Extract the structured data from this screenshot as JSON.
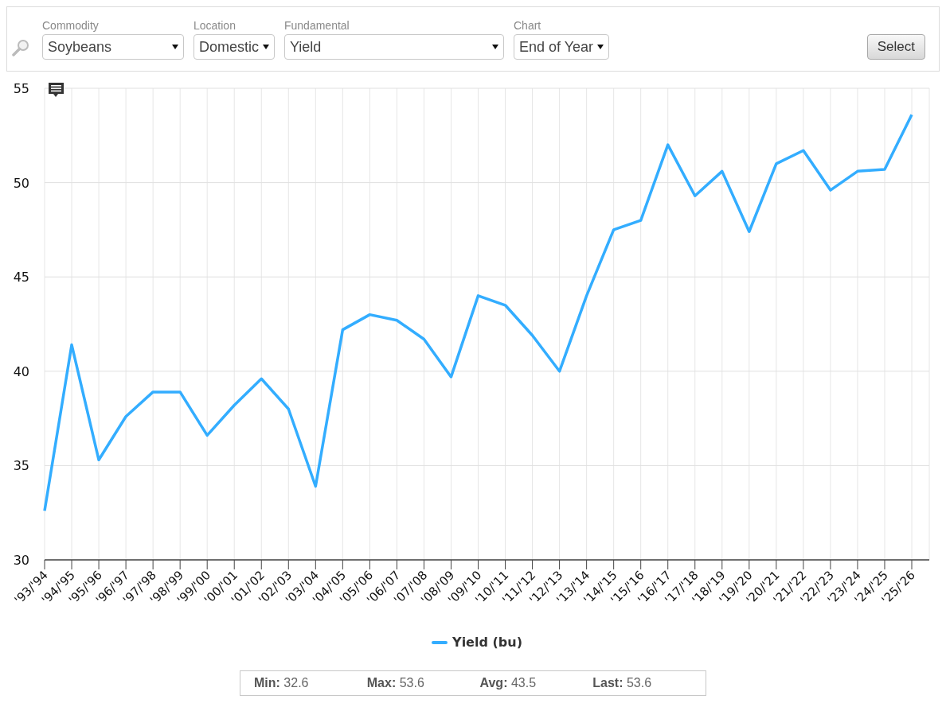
{
  "filters": [
    {
      "label": "Commodity",
      "value": "Soybeans"
    },
    {
      "label": "Location",
      "value": "Domestic"
    },
    {
      "label": "Fundamental",
      "value": "Yield"
    },
    {
      "label": "Chart",
      "value": "End of Year"
    }
  ],
  "select_button": "Select",
  "chart": {
    "chart_data": {
      "type": "line",
      "categories": [
        "'93/'94",
        "'94/'95",
        "'95/'96",
        "'96/'97",
        "'97/'98",
        "'98/'99",
        "'99/'00",
        "'00/'01",
        "'01/'02",
        "'02/'03",
        "'03/'04",
        "'04/'05",
        "'05/'06",
        "'06/'07",
        "'07/'08",
        "'08/'09",
        "'09/'10",
        "'10/'11",
        "'11/'12",
        "'12/'13",
        "'13/'14",
        "'14/'15",
        "'15/'16",
        "'16/'17",
        "'17/'18",
        "'18/'19",
        "'19/'20",
        "'20/'21",
        "'21/'22",
        "'22/'23",
        "'23/'24",
        "'24/'25",
        "'25/'26"
      ],
      "series": [
        {
          "name": "Yield (bu)",
          "color": "#33adff",
          "values": [
            32.6,
            41.4,
            35.3,
            37.6,
            38.9,
            38.9,
            36.6,
            38.2,
            39.6,
            38.0,
            33.9,
            42.2,
            43.0,
            42.7,
            41.7,
            39.7,
            44.0,
            43.5,
            41.9,
            40.0,
            44.0,
            47.5,
            48.0,
            52.0,
            49.3,
            50.6,
            47.4,
            51.0,
            51.7,
            49.6,
            50.6,
            50.7,
            53.6
          ]
        }
      ],
      "grid": true,
      "ylim": [
        30,
        55
      ],
      "yticks": [
        30,
        35,
        40,
        45,
        50,
        55
      ]
    }
  },
  "stats": [
    {
      "label": "Min:",
      "value": "32.6"
    },
    {
      "label": "Max:",
      "value": "53.6"
    },
    {
      "label": "Avg:",
      "value": "43.5"
    },
    {
      "label": "Last:",
      "value": "53.6"
    }
  ]
}
